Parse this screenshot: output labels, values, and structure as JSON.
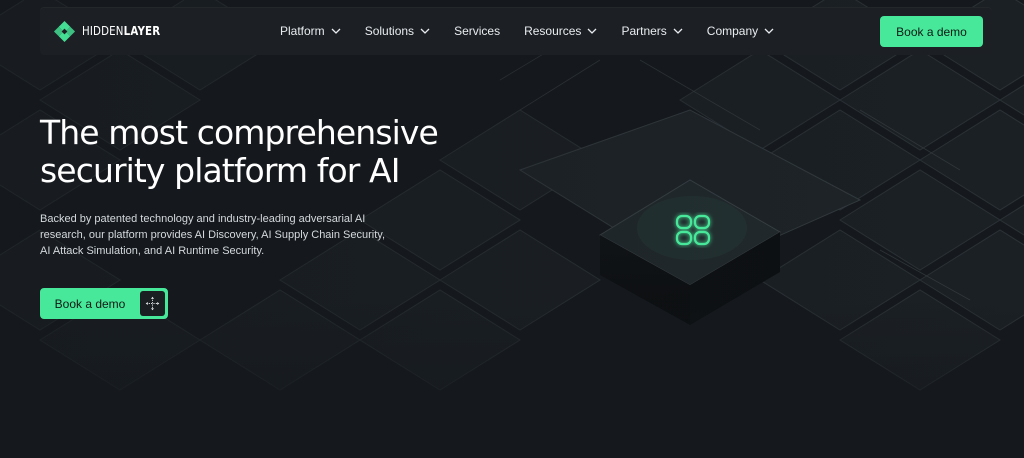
{
  "brand": {
    "name_part1": "HIDDEN",
    "name_part2": "LAYER",
    "logo_icon": "hiddenlayer-logo-icon",
    "accent": "#47e89a"
  },
  "nav": {
    "items": [
      {
        "label": "Platform",
        "has_dropdown": true
      },
      {
        "label": "Solutions",
        "has_dropdown": true
      },
      {
        "label": "Services",
        "has_dropdown": false
      },
      {
        "label": "Resources",
        "has_dropdown": true
      },
      {
        "label": "Partners",
        "has_dropdown": true
      },
      {
        "label": "Company",
        "has_dropdown": true
      }
    ],
    "cta_label": "Book a demo"
  },
  "hero": {
    "title_line1": "The most comprehensive",
    "title_line2": "security platform for AI",
    "description": "Backed by patented technology and industry-leading adversarial AI research, our platform provides AI Discovery, AI Supply Chain Security, AI Attack Simulation, and AI Runtime Security.",
    "cta_label": "Book a demo",
    "cta_icon": "move-crosshair-icon"
  },
  "colors": {
    "background": "#15191d",
    "navbar": "#1c2024",
    "accent_green": "#47e89a",
    "text_primary": "#ffffff",
    "text_secondary": "#d4d9dd"
  }
}
